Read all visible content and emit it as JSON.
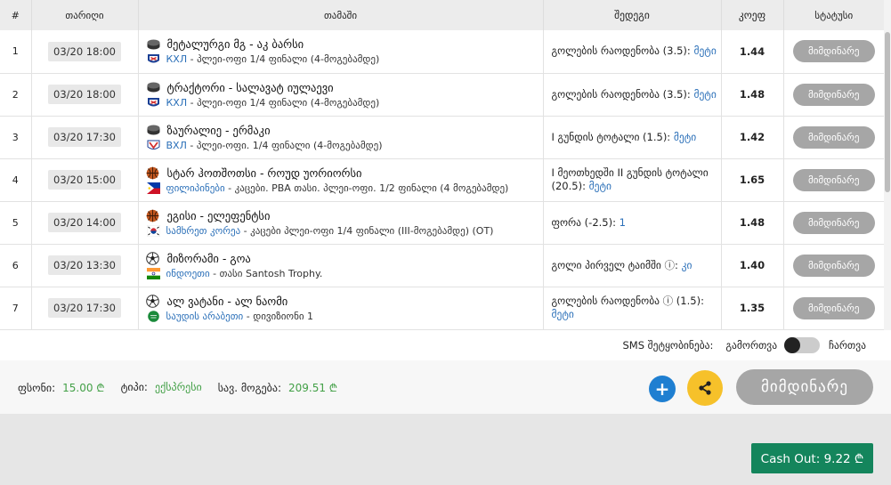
{
  "headers": {
    "num": "#",
    "date": "თარიღი",
    "game": "თამაში",
    "outcome": "შედეგი",
    "odds": "კოეფ",
    "status": "სტატუსი"
  },
  "rows": [
    {
      "num": "1",
      "date": "03/20 18:00",
      "teams": "მეტალურგი მგ - აკ ბარსი",
      "league": "КХЛ",
      "stage": " - პლეი-ოფი 1/4 ფინალი (4-მოგებამდე)",
      "outcome": "გოლების რაოდენობა (3.5): ",
      "pick": "მეტი",
      "odds": "1.44",
      "status": "მიმდინარე",
      "sport_icon": "hockey-puck-icon",
      "flag_icon": "khl-logo-icon"
    },
    {
      "num": "2",
      "date": "03/20 18:00",
      "teams": "ტრაქტორი - სალავატ იულაევი",
      "league": "КХЛ",
      "stage": " - პლეი-ოფი 1/4 ფინალი (4-მოგებამდე)",
      "outcome": "გოლების რაოდენობა (3.5): ",
      "pick": "მეტი",
      "odds": "1.48",
      "status": "მიმდინარე",
      "sport_icon": "hockey-puck-icon",
      "flag_icon": "khl-logo-icon"
    },
    {
      "num": "3",
      "date": "03/20 17:30",
      "teams": "ზაურალიე - ერმაკი",
      "league": "ВХЛ",
      "stage": " - პლეი-ოფი. 1/4 ფინალი (4-მოგებამდე)",
      "outcome": "I გუნდის ტოტალი (1.5): ",
      "pick": "მეტი",
      "odds": "1.42",
      "status": "მიმდინარე",
      "sport_icon": "hockey-puck-icon",
      "flag_icon": "vhl-logo-icon"
    },
    {
      "num": "4",
      "date": "03/20 15:00",
      "teams": "სტარ ჰოთშოთსი - როუდ უორიორსი",
      "league": "ფილიპინები",
      "stage": " - კაცები. PBA თასი. პლეი-ოფი. 1/2 ფინალი (4 მოგებამდე)",
      "outcome": "I მეოთხედში II გუნდის ტოტალი (20.5): ",
      "pick": "მეტი",
      "odds": "1.65",
      "status": "მიმდინარე",
      "sport_icon": "basketball-icon",
      "flag_icon": "philippines-flag-icon"
    },
    {
      "num": "5",
      "date": "03/20 14:00",
      "teams": "ეგისი - ელეფენტსი",
      "league": "სამხრეთ კორეა",
      "stage": " - კაცები პლეი-ოფი 1/4 ფინალი (III-მოგებამდე) (OT)",
      "outcome": "ფორა (-2.5): ",
      "pick": "1",
      "odds": "1.48",
      "status": "მიმდინარე",
      "sport_icon": "basketball-icon",
      "flag_icon": "south-korea-flag-icon"
    },
    {
      "num": "6",
      "date": "03/20 13:30",
      "teams": "მიზორამი - გოა",
      "league": "ინდოეთი",
      "stage": " - თასი Santosh Trophy.",
      "outcome": "გოლი პირველ ტაიმში ⓘ: ",
      "pick": "კი",
      "odds": "1.40",
      "status": "მიმდინარე",
      "sport_icon": "soccer-ball-icon",
      "flag_icon": "india-flag-icon"
    },
    {
      "num": "7",
      "date": "03/20 17:30",
      "teams": "ალ ვატანი - ალ ნაომი",
      "league": "საუდის არაბეთი",
      "stage": " - დივიზიონი 1",
      "outcome": "გოლების რაოდენობა ⓘ (1.5): ",
      "pick": "მეტი",
      "odds": "1.35",
      "status": "მიმდინარე",
      "sport_icon": "soccer-ball-icon",
      "flag_icon": "saudi-arabia-flag-icon"
    }
  ],
  "sms": {
    "label": "SMS შეტყობინება:",
    "off_label": "გამორთვა",
    "on_label": "ჩართვა"
  },
  "summary": {
    "stake_label": "ფსონი:",
    "stake_value": "15.00 ₾",
    "type_label": "ტიპი:",
    "type_value": "ექსპრესი",
    "win_label": "სავ. მოგება:",
    "win_value": "209.51 ₾"
  },
  "actions": {
    "add_symbol": "+",
    "status_big": "მიმდინარე",
    "cashout": "Cash Out: 9.22 ₾"
  },
  "colors": {
    "accent_green": "#43a047",
    "link_blue": "#2a6fb8",
    "cashout_green": "#14855c",
    "add_blue": "#1f7fd1",
    "share_yellow": "#f6c12a",
    "status_grey": "#a6a6a6"
  }
}
